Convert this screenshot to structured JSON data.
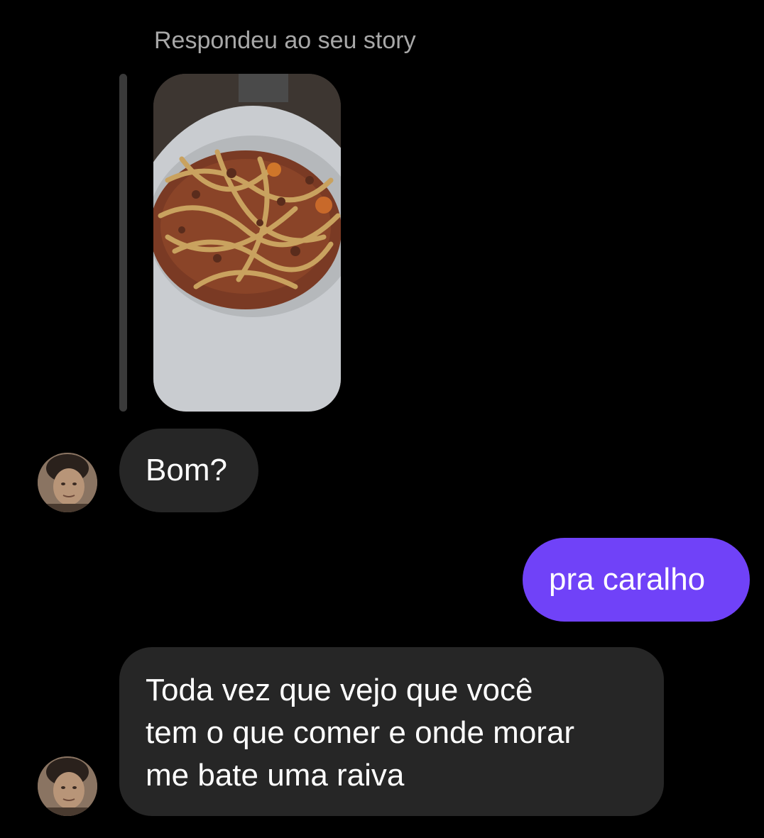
{
  "reply_context": {
    "label": "Respondeu ao seu story",
    "story_thumbnail": {
      "icon": "story-image-thumbnail"
    }
  },
  "messages": [
    {
      "direction": "incoming",
      "avatar": "avatar-icon",
      "text": "Bom?"
    },
    {
      "direction": "outgoing",
      "text": "pra caralho"
    },
    {
      "direction": "incoming",
      "avatar": "avatar-icon",
      "lines": [
        "Toda vez que vejo que você",
        "tem o que comer e onde morar",
        "me bate uma raiva"
      ]
    }
  ],
  "colors": {
    "background": "#000000",
    "incoming_bubble": "#262626",
    "outgoing_bubble": "#7042f8",
    "secondary_text": "#a8a8a8"
  }
}
